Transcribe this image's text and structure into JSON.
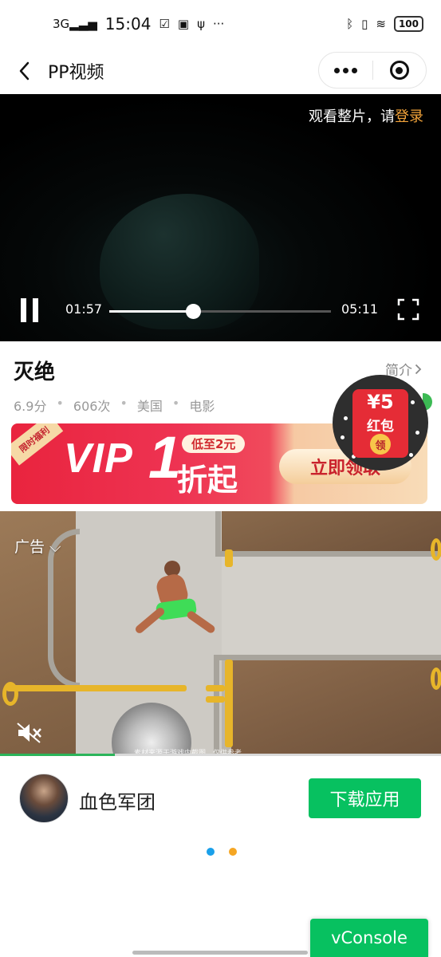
{
  "status_bar": {
    "network": "3G",
    "time": "15:04",
    "battery": "100",
    "colors": {
      "text": "#111111"
    }
  },
  "nav": {
    "title": "PP视频",
    "back_icon": "chevron-left-icon",
    "more_icon": "more-dots-icon",
    "close_icon": "target-circle-icon"
  },
  "player": {
    "login_prefix": "观看整片，请",
    "login_link": "登录",
    "current_time": "01:57",
    "total_time": "05:11",
    "progress": 0.376,
    "colors": {
      "login_link": "#f2a33a"
    }
  },
  "movie": {
    "title": "灭绝",
    "intro_label": "简介",
    "rating": "6.9分",
    "plays": "606次",
    "region": "美国",
    "category": "电影"
  },
  "vip_banner": {
    "ribbon": "限时福利",
    "vip": "VIP",
    "one": "1",
    "badge": "低至2元",
    "sub": "折起",
    "cta": "立即领取",
    "colors": {
      "primary": "#e9243e",
      "gold": "#f6c9a3"
    }
  },
  "red_packet": {
    "amount": "¥5",
    "label": "红包",
    "coin": "领",
    "colors": {
      "card": "#e52c36",
      "bg": "#2e2e2e"
    }
  },
  "ad": {
    "label": "广告",
    "caption": "素材来源于游戏内截图，仅供参考",
    "mute_icon": "mute-speaker-icon",
    "progress": 0.26
  },
  "app": {
    "name": "血色军团",
    "download_label": "下载应用",
    "colors": {
      "button": "#07c160"
    }
  },
  "pager": {
    "dots": [
      {
        "color": "#1aa0ea",
        "active": true
      },
      {
        "color": "#f5a623",
        "active": false
      }
    ]
  },
  "vconsole": {
    "label": "vConsole"
  }
}
